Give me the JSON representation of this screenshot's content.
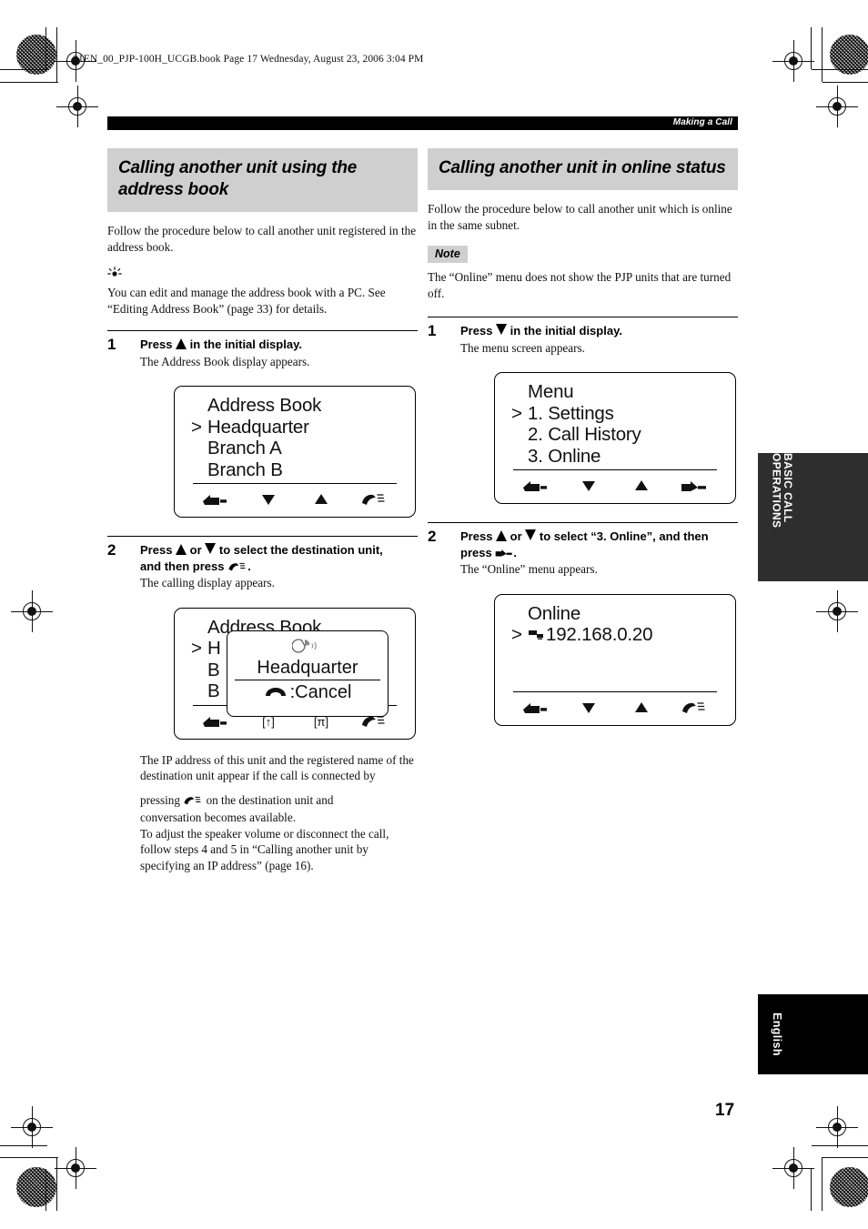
{
  "page": {
    "file_info": "01EN_00_PJP-100H_UCGB.book  Page 17  Wednesday, August 23, 2006  3:04 PM",
    "running_head": "Making a Call",
    "page_number": "17"
  },
  "tabs": {
    "chapter": "BASIC CALL OPERATIONS",
    "language": "English"
  },
  "left_column": {
    "title": "Calling another unit using the address book",
    "intro": "Follow the procedure below to call another unit registered in the address book.",
    "tip_glyph": "☀",
    "tip_text": "You can edit and manage the address book with a PC. See “Editing Address Book” (page 33) for details.",
    "steps": [
      {
        "number": "1",
        "head_before": "Press",
        "head_icon": "up-triangle-icon",
        "head_after": "in the initial display.",
        "sub": "The Address Book display appears."
      },
      {
        "number": "2",
        "head_line1_before": "Press",
        "head_line1_mid": "or",
        "head_line1_after": "to select the destination unit,",
        "head_line2_before": "and then press",
        "head_line2_after": ".",
        "sub": "The calling display appears."
      }
    ],
    "lcd1": {
      "line1": "Address Book",
      "line2": "Headquarter",
      "line3": "Branch A",
      "line4": "Branch B",
      "caret": ">",
      "softkeys": [
        "back-icon",
        "down-triangle-icon",
        "up-triangle-icon",
        "phone-icon"
      ]
    },
    "lcd2": {
      "line1": "Address Book",
      "line2": "H",
      "line3": "B",
      "line4": "B",
      "caret": ">",
      "softkeys": [
        "back-icon",
        "up-bracket-icon",
        "pi-bracket-icon",
        "phone-icon"
      ],
      "popup": {
        "status_icon": "calling-icon",
        "name": "Headquarter",
        "cancel_icon": "hangup-icon",
        "cancel_label": ":Cancel"
      }
    },
    "after_text_1": "The IP address of this unit and the registered name of the destination unit appear if the call is connected by",
    "after_text_2_before": "pressing",
    "after_text_2_after": "on the destination unit and",
    "after_text_3": "conversation becomes available.",
    "after_text_4": "To adjust the speaker volume or disconnect the call, follow steps 4 and 5 in “Calling another unit by specifying an IP address” (page 16)."
  },
  "right_column": {
    "title": "Calling another unit in online status",
    "intro": "Follow the procedure below to call another unit which is online in the same subnet.",
    "note_badge": "Note",
    "note_text": "The “Online” menu does not show the PJP units that are turned off.",
    "steps": [
      {
        "number": "1",
        "head_before": "Press",
        "head_icon": "down-triangle-icon",
        "head_after": "in the initial display.",
        "sub": "The menu screen appears."
      },
      {
        "number": "2",
        "head_line1_before": "Press",
        "head_line1_mid": "or",
        "head_line1_after": "to select “3. Online”, and then",
        "head_line2_before": "press",
        "head_line2_after": ".",
        "sub": "The “Online” menu appears."
      }
    ],
    "lcd1": {
      "line1": "Menu",
      "line2": "1. Settings",
      "line3": "2. Call History",
      "line4": "3. Online",
      "caret": ">",
      "softkeys": [
        "back-icon",
        "down-triangle-icon",
        "up-triangle-icon",
        "enter-icon"
      ]
    },
    "lcd2": {
      "line1": "Online",
      "line2": "192.168.0.20",
      "line2_icon": "network-unit-icon",
      "caret": ">",
      "softkeys": [
        "back-icon",
        "down-triangle-icon",
        "up-triangle-icon",
        "phone-icon"
      ]
    }
  },
  "colors": {
    "section_title_bg": "#cfcfcf",
    "running_head_bg": "#000000",
    "chapter_tab_bg": "#2e2e2e",
    "language_tab_bg": "#000000",
    "text": "#111111"
  }
}
